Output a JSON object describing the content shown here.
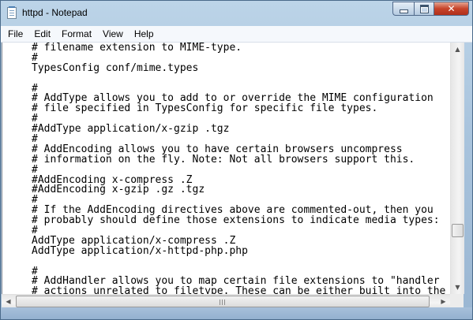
{
  "window": {
    "title": "httpd - Notepad",
    "app_icon": "notepad-icon"
  },
  "caption_buttons": {
    "minimize_icon": "minimize-icon",
    "maximize_icon": "maximize-icon",
    "close_glyph": "✕"
  },
  "menu": {
    "items": [
      "File",
      "Edit",
      "Format",
      "View",
      "Help"
    ]
  },
  "editor": {
    "lines": [
      "# filename extension to MIME-type.",
      "#",
      "TypesConfig conf/mime.types",
      "",
      "#",
      "# AddType allows you to add to or override the MIME configuration",
      "# file specified in TypesConfig for specific file types.",
      "#",
      "#AddType application/x-gzip .tgz",
      "#",
      "# AddEncoding allows you to have certain browsers uncompress",
      "# information on the fly. Note: Not all browsers support this.",
      "#",
      "#AddEncoding x-compress .Z",
      "#AddEncoding x-gzip .gz .tgz",
      "#",
      "# If the AddEncoding directives above are commented-out, then you",
      "# probably should define those extensions to indicate media types:",
      "#",
      "AddType application/x-compress .Z",
      "AddType application/x-httpd-php.php",
      "",
      "#",
      "# AddHandler allows you to map certain file extensions to \"handler",
      "# actions unrelated to filetype. These can be either built into the"
    ]
  },
  "scrollbars": {
    "vertical_up_glyph": "▲",
    "vertical_down_glyph": "▼",
    "horizontal_left_glyph": "◀",
    "horizontal_right_glyph": "▶"
  },
  "colors": {
    "titlebar": "#a9c4dd",
    "close_button": "#c7432a",
    "editor_background": "#ffffff"
  }
}
